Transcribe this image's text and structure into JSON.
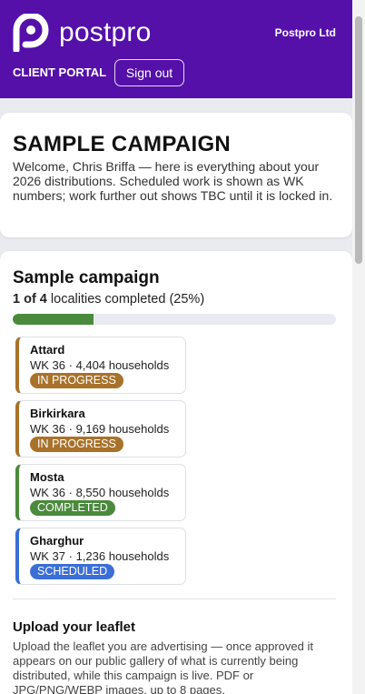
{
  "header": {
    "brand": "postpro",
    "org_name": "Postpro Ltd",
    "portal_label": "CLIENT PORTAL",
    "signout_label": "Sign out",
    "brand_color": "#5410a8"
  },
  "welcome_card": {
    "title": "SAMPLE CAMPAIGN",
    "text": "Welcome, Chris Briffa — here is everything about your 2026 distributions. Scheduled work is shown as WK numbers; work further out shows TBC until it is locked in."
  },
  "campaign": {
    "title": "Sample campaign",
    "progress_count": "1 of 4",
    "progress_rest": " localities completed (25%)",
    "progress_fraction": 0.25,
    "localities": [
      {
        "name": "Attard",
        "meta": "WK 36 · 4,404 households",
        "status": "IN PROGRESS",
        "color": "#a8722a"
      },
      {
        "name": "Birkirkara",
        "meta": "WK 36 · 9,169 households",
        "status": "IN PROGRESS",
        "color": "#a8722a"
      },
      {
        "name": "Mosta",
        "meta": "WK 36 · 8,550 households",
        "status": "COMPLETED",
        "color": "#4a8a3c"
      },
      {
        "name": "Gharghur",
        "meta": "WK 37 · 1,236 households",
        "status": "SCHEDULED",
        "color": "#3b6fd6"
      }
    ]
  },
  "upload": {
    "title": "Upload your leaflet",
    "text": "Upload the leaflet you are advertising — once approved it appears on our public gallery of what is currently being distributed, while this campaign is live. PDF or JPG/PNG/WEBP images, up to 8 pages."
  }
}
